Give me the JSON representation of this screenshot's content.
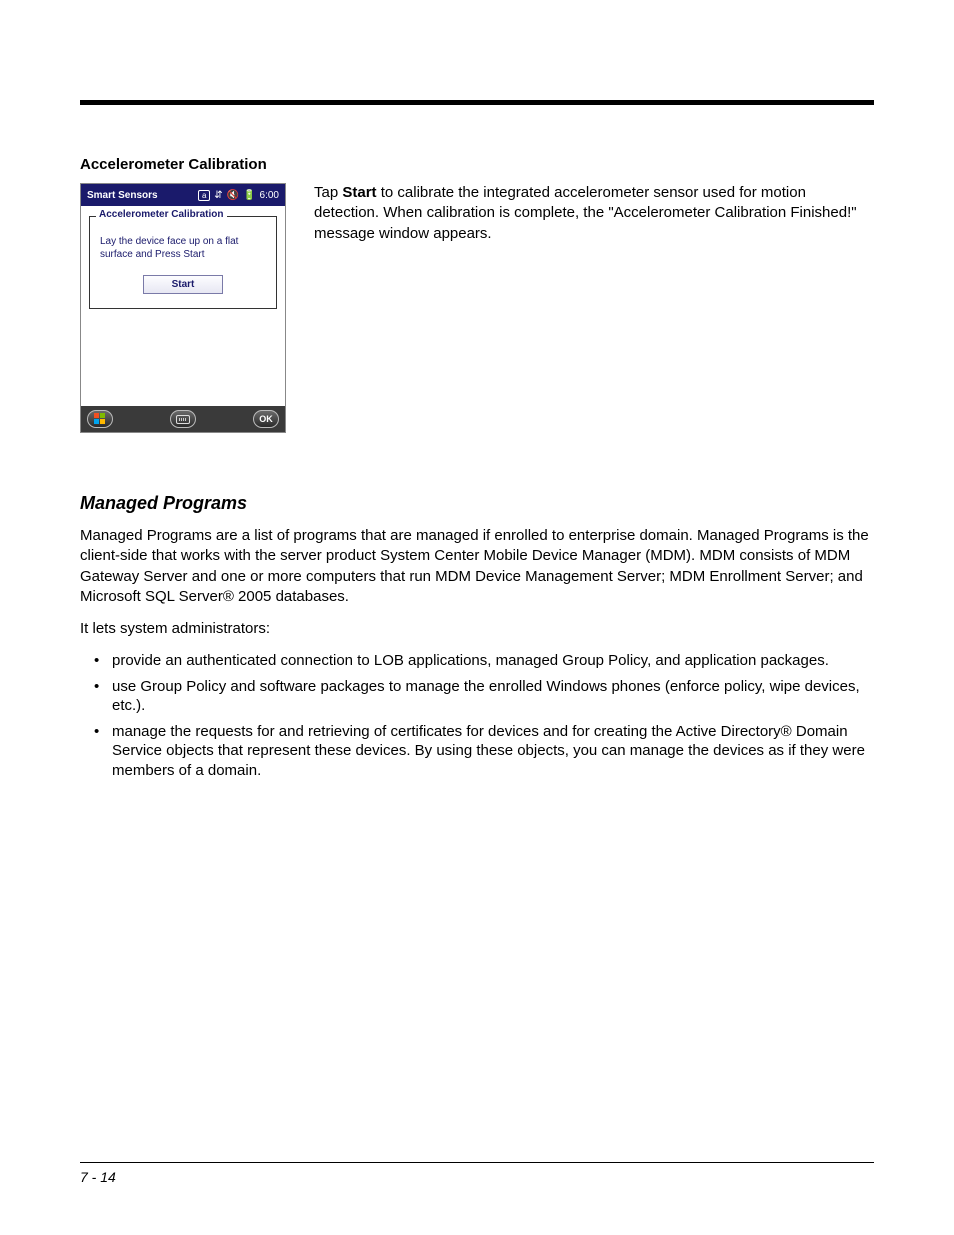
{
  "section1": {
    "title": "Accelerometer Calibration",
    "device": {
      "topbar": {
        "title": "Smart Sensors",
        "clock": "6:00",
        "input_mode": "a"
      },
      "fieldset": {
        "legend": "Accelerometer Calibration",
        "instruction": "Lay the device face up on a flat surface and Press Start",
        "button": "Start"
      },
      "bottom": {
        "ok": "OK"
      }
    },
    "desc_pre": "Tap ",
    "desc_bold": "Start",
    "desc_post": " to calibrate the integrated accelerometer sensor used for motion detection. When calibration is complete, the \"Accelerometer Calibration Finished!\" message window appears."
  },
  "section2": {
    "heading": "Managed Programs",
    "para1": "Managed Programs are a list of programs that are managed if enrolled to enterprise domain. Managed Programs is the client-side that works with the server product System Center Mobile Device Manager (MDM). MDM consists of MDM Gateway Server and one or more computers that run MDM Device Management Server; MDM Enrollment Server; and Microsoft SQL Server® 2005 databases.",
    "para2": "It lets system administrators:",
    "bullets": [
      "provide an authenticated connection to LOB applications, managed Group Policy, and application packages.",
      "use Group Policy and software packages to manage the enrolled Windows phones (enforce policy, wipe devices, etc.).",
      "manage the requests for and retrieving of certificates for devices and for creating the Active Directory® Domain Service objects that represent these devices. By using these objects, you can manage the devices as if they were members of a domain."
    ]
  },
  "footer": {
    "page": "7 - 14"
  }
}
